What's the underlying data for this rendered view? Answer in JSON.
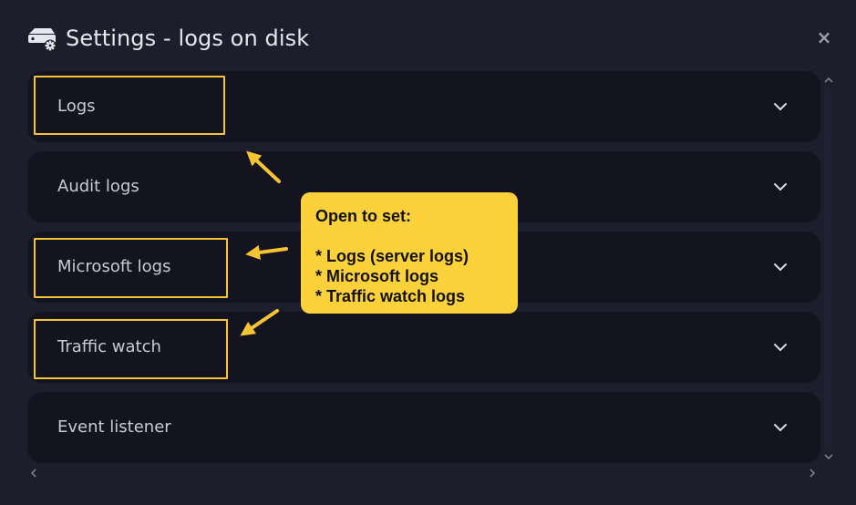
{
  "dialog": {
    "title": "Settings - logs on disk",
    "close_label": "×"
  },
  "panels": [
    {
      "label": "Logs"
    },
    {
      "label": "Audit logs"
    },
    {
      "label": "Microsoft logs"
    },
    {
      "label": "Traffic watch"
    },
    {
      "label": "Event listener"
    }
  ],
  "annotation": {
    "heading": "Open to set:",
    "items": [
      "* Logs (server logs)",
      "* Microsoft logs",
      "* Traffic watch logs"
    ],
    "color": "#fdd13a",
    "outline_color": "#f7c433"
  },
  "icons": {
    "header": "server-settings-icon",
    "expand": "chevron-down-icon"
  }
}
